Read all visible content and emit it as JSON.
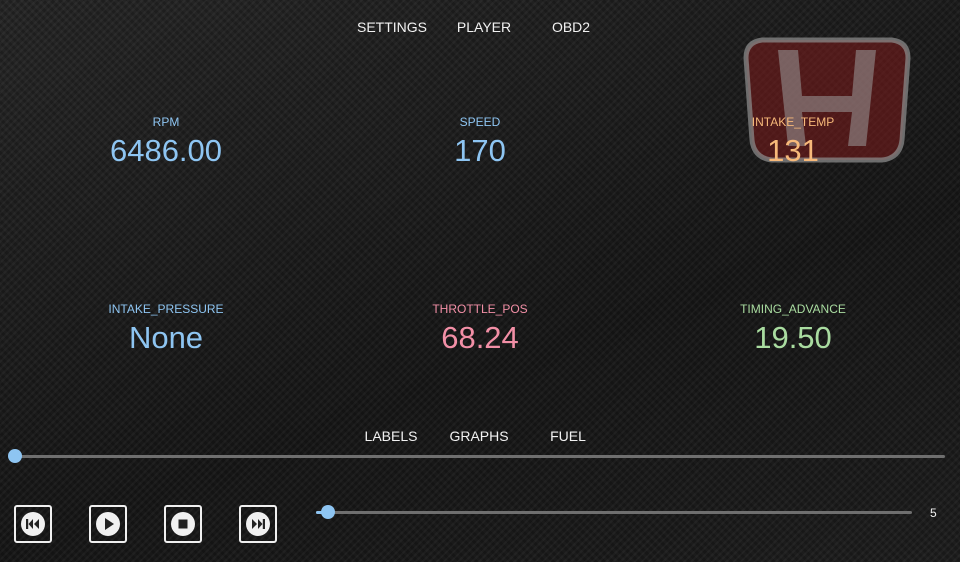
{
  "top_menu": [
    "SETTINGS",
    "PLAYER",
    "OBD2"
  ],
  "gauges": [
    {
      "label": "RPM",
      "value": "6486.00",
      "color": "#8ec5f2"
    },
    {
      "label": "SPEED",
      "value": "170",
      "color": "#8ec5f2"
    },
    {
      "label": "INTAKE_TEMP",
      "value": "131",
      "color": "#f7b97a"
    },
    {
      "label": "INTAKE_PRESSURE",
      "value": "None",
      "color": "#8ec5f2"
    },
    {
      "label": "THROTTLE_POS",
      "value": "68.24",
      "color": "#f28fa6"
    },
    {
      "label": "TIMING_ADVANCE",
      "value": "19.50",
      "color": "#a9dca0"
    }
  ],
  "bottom_menu": [
    "LABELS",
    "GRAPHS",
    "FUEL"
  ],
  "progress": {
    "fraction": 0.0
  },
  "playback_controls": {
    "previous_icon": "skip-previous-icon",
    "play_icon": "play-icon",
    "stop_icon": "stop-icon",
    "next_icon": "skip-next-icon"
  },
  "volume": {
    "value": "5",
    "fraction": 0.02
  },
  "logo": {
    "name": "honda-logo",
    "color": "#8b1e1e"
  },
  "colors": {
    "accent": "#8ec5f2",
    "text": "#f2f2f2"
  }
}
